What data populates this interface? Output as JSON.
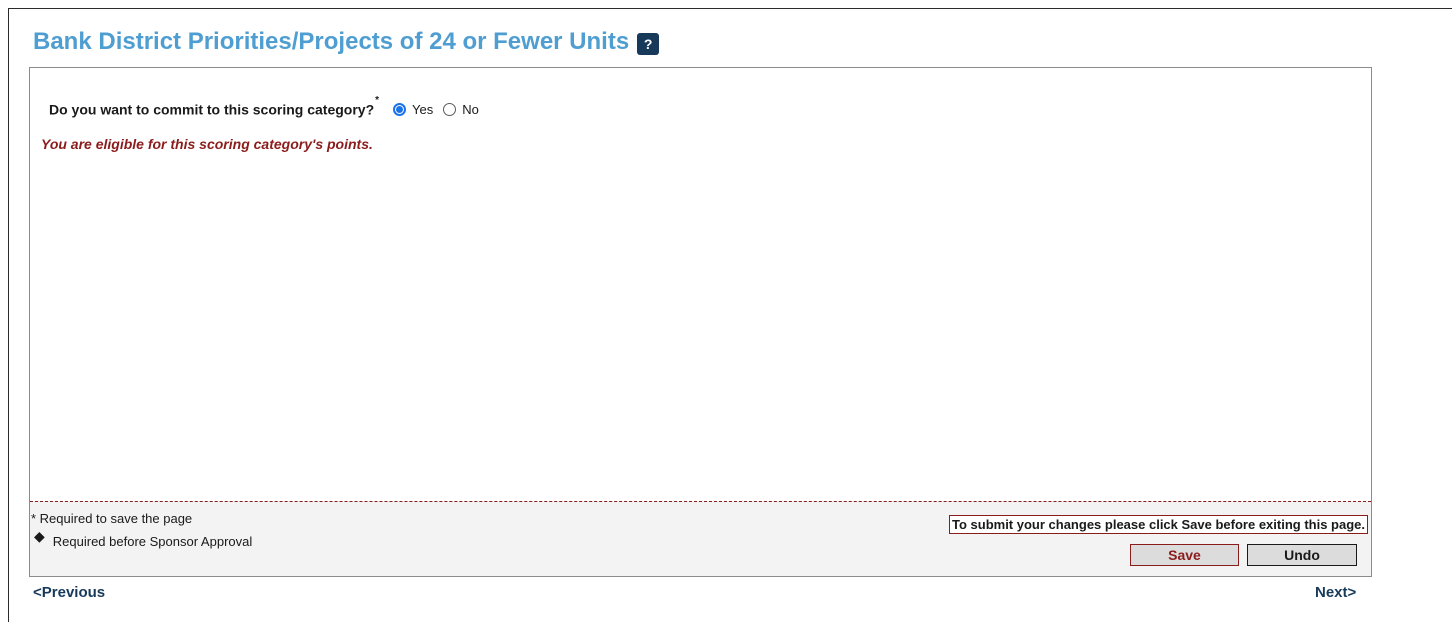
{
  "page": {
    "title": "Bank District Priorities/Projects of 24 or Fewer Units",
    "help_icon": "question-help-icon"
  },
  "question": {
    "label": "Do you want to commit to this scoring category?",
    "required_marker": "*",
    "options": [
      {
        "label": "Yes",
        "selected": true
      },
      {
        "label": "No",
        "selected": false
      }
    ]
  },
  "messages": {
    "eligible": "You are eligible for this scoring category's points."
  },
  "footer": {
    "required_legend": "* Required to save the page",
    "sponsor_legend_icon": "diamond-icon",
    "sponsor_legend": "Required before Sponsor Approval",
    "submit_notice": "To submit your changes please click Save before exiting this page.",
    "save_label": "Save",
    "undo_label": "Undo"
  },
  "nav": {
    "previous": "<Previous",
    "next": "Next>"
  },
  "colors": {
    "title": "#4f9ed1",
    "accent_red": "#8b1c1c",
    "nav_link": "#173a5b",
    "radio_selected": "#1a73e8"
  }
}
